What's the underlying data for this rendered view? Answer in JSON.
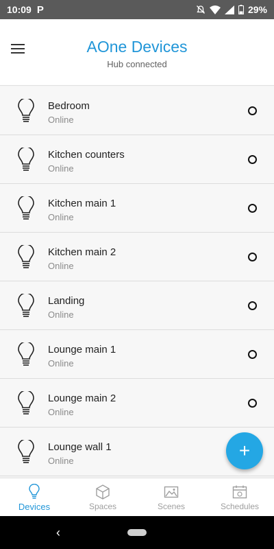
{
  "status_bar": {
    "time": "10:09",
    "battery": "29%"
  },
  "header": {
    "title": "AOne Devices",
    "subtitle": "Hub connected"
  },
  "devices": [
    {
      "name": "Bedroom",
      "status": "Online"
    },
    {
      "name": "Kitchen counters",
      "status": "Online"
    },
    {
      "name": "Kitchen main 1",
      "status": "Online"
    },
    {
      "name": "Kitchen main 2",
      "status": "Online"
    },
    {
      "name": "Landing",
      "status": "Online"
    },
    {
      "name": "Lounge main 1",
      "status": "Online"
    },
    {
      "name": "Lounge main 2",
      "status": "Online"
    },
    {
      "name": "Lounge wall 1",
      "status": "Online"
    }
  ],
  "fab": {
    "label": "+"
  },
  "bottom_nav": [
    {
      "label": "Devices",
      "icon": "bulb-icon",
      "active": true
    },
    {
      "label": "Spaces",
      "icon": "cube-icon",
      "active": false
    },
    {
      "label": "Scenes",
      "icon": "image-icon",
      "active": false
    },
    {
      "label": "Schedules",
      "icon": "calendar-icon",
      "active": false
    }
  ],
  "colors": {
    "accent": "#2196d8",
    "fab": "#24a7e4"
  }
}
